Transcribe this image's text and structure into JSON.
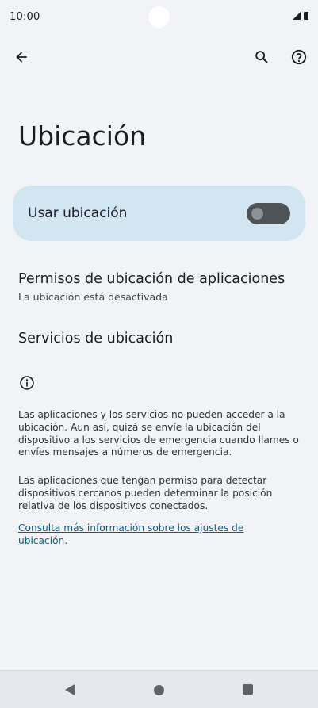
{
  "status_bar": {
    "time": "10:00"
  },
  "app_bar": {
    "back_icon": "arrow-back-icon",
    "search_icon": "search-icon",
    "help_icon": "help-icon"
  },
  "page": {
    "title": "Ubicación"
  },
  "main_toggle": {
    "label": "Usar ubicación",
    "checked": false
  },
  "items": [
    {
      "title": "Permisos de ubicación de aplicaciones",
      "subtitle": "La ubicación está desactivada"
    },
    {
      "title": "Servicios de ubicación"
    }
  ],
  "info": {
    "icon": "info-icon",
    "paragraph_1": "Las aplicaciones y los servicios no pueden acceder a la ubicación. Aun así, quizá se envíe la ubicación del dispositivo a los servicios de emergencia cuando llames o envíes mensajes a números de emergencia.",
    "paragraph_2": "Las aplicaciones que tengan permiso para detectar dispositivos cercanos pueden determinar la posición relativa de los dispositivos conectados.",
    "link": "Consulta más información sobre los ajustes de ubicación."
  },
  "colors": {
    "background": "#f1f3f6",
    "toggle_card": "#d2e6f2",
    "toggle_track_off": "#4e5357",
    "link": "#0f5c80"
  }
}
